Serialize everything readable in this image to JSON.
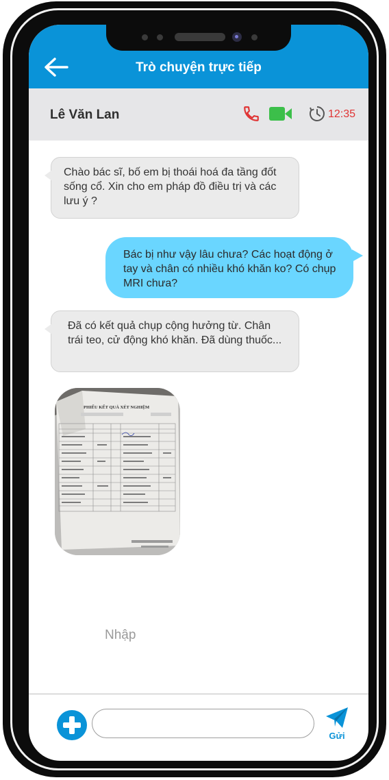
{
  "header": {
    "title": "Trò chuyện trực tiếp",
    "back_icon": "arrow-left-icon"
  },
  "contact": {
    "name": "Lê Văn Lan",
    "call_icon": "phone-icon",
    "video_icon": "video-camera-icon",
    "timer_icon": "clock-icon",
    "timer": "12:35"
  },
  "colors": {
    "primary": "#0a93d8",
    "outgoing_bubble": "#6ad6ff",
    "incoming_bubble": "#ebebeb",
    "call": "#e03434",
    "video": "#3cbf4a"
  },
  "messages": [
    {
      "direction": "in",
      "text": "Chào bác sĩ, bố em bị thoái hoá đa tầng đốt sống cổ. Xin cho em pháp đồ điều trị và các lưu ý ?"
    },
    {
      "direction": "out",
      "text": "Bác bị như vậy lâu chưa? Các hoạt động ở tay và chân có nhiều khó khăn ko? Có chụp MRI chưa?"
    },
    {
      "direction": "in",
      "text": "Đã có kết quả chụp cộng hưởng từ. Chân trái teo, cử động khó khăn. Đã dùng thuốc..."
    }
  ],
  "attachment": {
    "type": "photo",
    "title": "PHIẾU KẾT QUẢ XÉT NGHIỆM"
  },
  "composer": {
    "hint": "Nhập",
    "input_value": "",
    "add_icon": "plus-circle-icon",
    "send_icon": "paper-plane-icon",
    "send_label": "Gửi"
  }
}
